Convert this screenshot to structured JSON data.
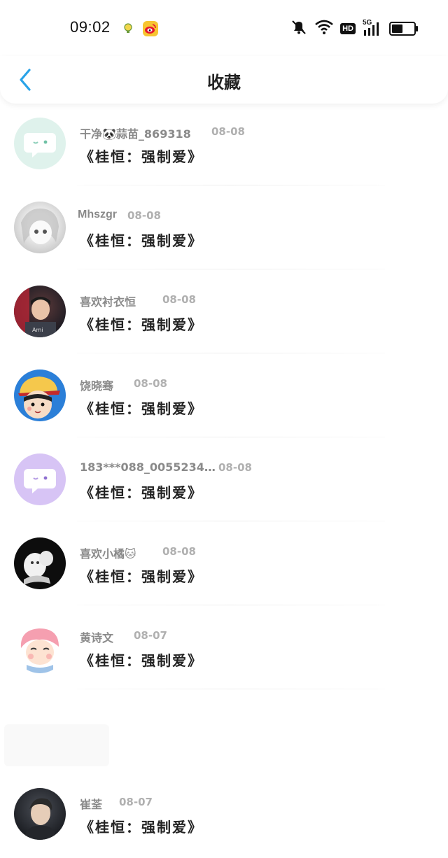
{
  "status": {
    "time": "09:02",
    "icons": [
      "lightbulb-app-icon",
      "weibo-app-icon",
      "mute-icon",
      "wifi-icon",
      "hd-icon",
      "5g-signal-icon",
      "battery-icon"
    ],
    "hd_label": "HD",
    "signal_label": "5G",
    "battery_level": 0.55
  },
  "nav": {
    "title": "收藏",
    "back_icon": "chevron-left-icon",
    "accent": "#29a3e8"
  },
  "items": [
    {
      "name": "干净🐼蒜苗_869318",
      "date": "08-08",
      "title": "《桂恒：强制爱》",
      "avatar": "chat-bubble-mint"
    },
    {
      "name": "Mhszgr",
      "date": "08-08",
      "title": "《桂恒：强制爱》",
      "avatar": "anime-girl-sketch"
    },
    {
      "name": "喜欢衬衣恒",
      "date": "08-08",
      "title": "《桂恒：强制爱》",
      "avatar": "boy-photo"
    },
    {
      "name": "饶晓骞",
      "date": "08-08",
      "title": "《桂恒：强制爱》",
      "avatar": "cartoon-girl-hat"
    },
    {
      "name": "183***088_0055234…",
      "date": "08-08",
      "title": "《桂恒：强制爱》",
      "avatar": "chat-bubble-purple"
    },
    {
      "name": "喜欢小橘🐱",
      "date": "08-08",
      "title": "《桂恒：强制爱》",
      "avatar": "white-kitten-dark"
    },
    {
      "name": "黄诗文",
      "date": "08-07",
      "title": "《桂恒：强制爱》",
      "avatar": "pink-hair-cartoon"
    },
    {
      "name": "崔荃",
      "date": "08-07",
      "title": "《桂恒：强制爱》",
      "avatar": "man-photo"
    }
  ]
}
